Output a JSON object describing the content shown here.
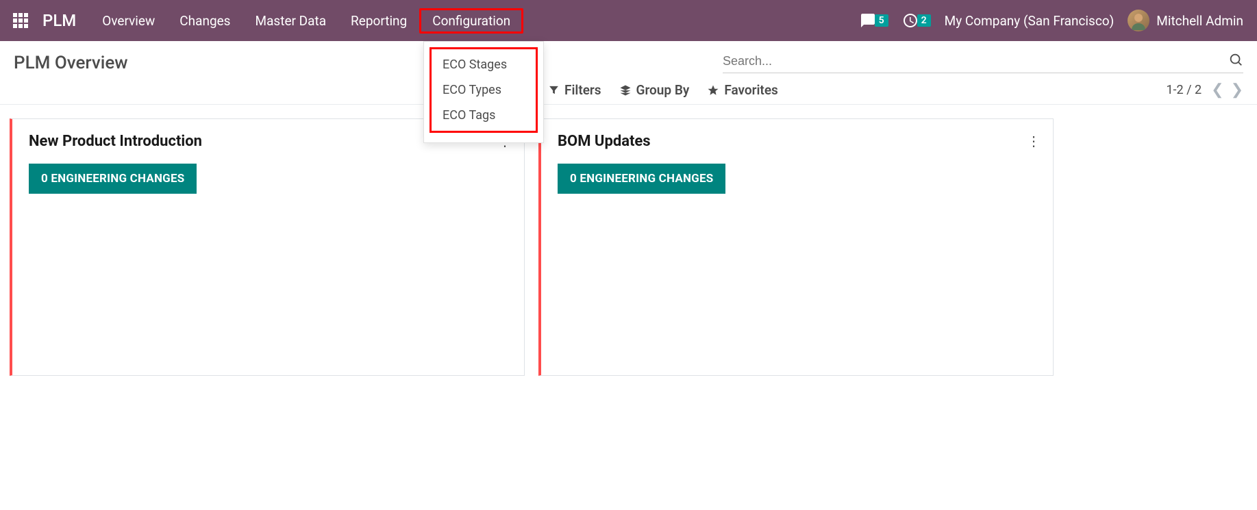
{
  "nav": {
    "brand": "PLM",
    "items": [
      "Overview",
      "Changes",
      "Master Data",
      "Reporting",
      "Configuration"
    ],
    "active_index": 4,
    "messages_badge": "5",
    "activity_badge": "2",
    "company": "My Company (San Francisco)",
    "user": "Mitchell Admin"
  },
  "dropdown": {
    "items": [
      "ECO Stages",
      "ECO Types",
      "ECO Tags"
    ]
  },
  "control": {
    "title": "PLM Overview",
    "search_placeholder": "Search...",
    "filters": "Filters",
    "groupby": "Group By",
    "favorites": "Favorites",
    "pager": "1-2 / 2"
  },
  "cards": [
    {
      "title": "New Product Introduction",
      "button": "0 ENGINEERING CHANGES"
    },
    {
      "title": "BOM Updates",
      "button": "0 ENGINEERING CHANGES"
    }
  ]
}
